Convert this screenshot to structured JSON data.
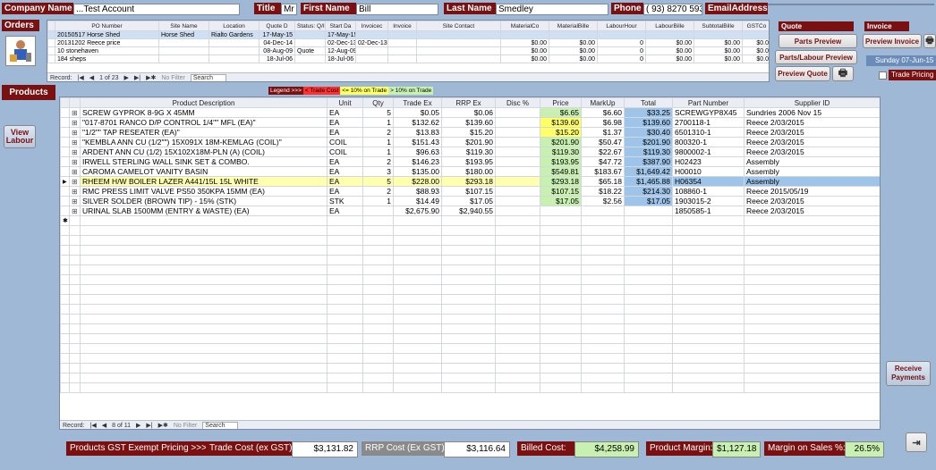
{
  "header": {
    "company_label": "Company Name",
    "company_value": "...Test Account",
    "title_label": "Title",
    "title_value": "Mr",
    "first_label": "First Name",
    "first_value": "Bill",
    "last_label": "Last Name",
    "last_value": "Smedley",
    "phone_label": "Phone",
    "phone_value": "( 93) 8270 5935",
    "email_label": "EmailAddress:",
    "email_value": ""
  },
  "orders": {
    "label": "Orders",
    "columns": [
      "PO Number",
      "Site Name",
      "Location",
      "Quote D",
      "Status: Q/I",
      "Start Da",
      "Invoicec",
      "Invoice",
      "Site Contact",
      "MaterialCo",
      "MaterialBille",
      "LabourHour",
      "LabourBille",
      "SubtotalBille",
      "GSTCo"
    ],
    "rows": [
      [
        "20150517 Horse Shed",
        "Horse Shed",
        "Rialto Gardens",
        "17-May-15",
        "",
        "17-May-15",
        "",
        "",
        "",
        "",
        "",
        "",
        "",
        "",
        ""
      ],
      [
        "20131202 Reece price",
        "",
        "",
        "04-Dec-14",
        "",
        "02-Dec-13",
        "02-Dec-13",
        "",
        "",
        "$0.00",
        "$0.00",
        "0",
        "$0.00",
        "$0.00",
        "$0.0"
      ],
      [
        "10 stonehaven",
        "",
        "",
        "08-Aug-09",
        "Quote",
        "12-Aug-09",
        "",
        "",
        "",
        "$0.00",
        "$0.00",
        "0",
        "$0.00",
        "$0.00",
        "$0.0"
      ],
      [
        "184 sheps",
        "",
        "",
        "18-Jul-06",
        "",
        "18-Jul-06",
        "",
        "",
        "",
        "$0.00",
        "$0.00",
        "0",
        "$0.00",
        "$0.00",
        "$0.0"
      ]
    ],
    "nav": {
      "record": "Record:",
      "pos": "1 of 23",
      "filter": "No Filter",
      "search": "Search"
    }
  },
  "quote": {
    "label": "Quote",
    "parts_preview": "Parts Preview",
    "parts_labour_preview": "Parts/Labour Preview",
    "preview_quote": "Preview Quote"
  },
  "invoice": {
    "label": "Invoice",
    "preview_invoice": "Preview Invoice",
    "date": "Sunday 07-Jun-15",
    "trade_pricing": "Trade Pricing"
  },
  "products": {
    "label": "Products",
    "view_labour": "View Labour",
    "legend": {
      "title": "Legend >>>",
      "red": "< Trade Cost",
      "yellow": "<= 10% on Trade",
      "green": "> 10% on Trade"
    },
    "columns": [
      "Product Description",
      "Unit",
      "Qty",
      "Trade Ex",
      "RRP Ex",
      "Disc %",
      "Price",
      "MarkUp",
      "Total",
      "Part Number",
      "Supplier ID"
    ],
    "rows": [
      {
        "desc": "SCREW GYPROK 8-9G X 45MM",
        "unit": "EA",
        "qty": "5",
        "trade": "$0.05",
        "rrp": "$0.06",
        "disc": "",
        "price": "$6.65",
        "markup": "$6.60",
        "total": "$33.25",
        "part": "SCREWGYP8X45",
        "supplier": "Sundries 2006 Nov 15",
        "pc": "green"
      },
      {
        "desc": "\"017-8701 RANCO D/P CONTROL 1/4\"\" MFL (EA)\"",
        "unit": "EA",
        "qty": "1",
        "trade": "$132.62",
        "rrp": "$139.60",
        "disc": "",
        "price": "$139.60",
        "markup": "$6.98",
        "total": "$139.60",
        "part": "2700118-1",
        "supplier": "Reece 2/03/2015",
        "pc": "yellow"
      },
      {
        "desc": "\"1/2\"\" TAP RESEATER (EA)\"",
        "unit": "EA",
        "qty": "2",
        "trade": "$13.83",
        "rrp": "$15.20",
        "disc": "",
        "price": "$15.20",
        "markup": "$1.37",
        "total": "$30.40",
        "part": "6501310-1",
        "supplier": "Reece 2/03/2015",
        "pc": "yellow"
      },
      {
        "desc": "\"KEMBLA ANN CU (1/2\"\") 15X091X 18M-KEMLAG (COIL)\"",
        "unit": "COIL",
        "qty": "1",
        "trade": "$151.43",
        "rrp": "$201.90",
        "disc": "",
        "price": "$201.90",
        "markup": "$50.47",
        "total": "$201.90",
        "part": "800320-1",
        "supplier": "Reece 2/03/2015",
        "pc": "green"
      },
      {
        "desc": "ARDENT ANN CU (1/2) 15X102X18M-PLN (A) (COIL)",
        "unit": "COIL",
        "qty": "1",
        "trade": "$96.63",
        "rrp": "$119.30",
        "disc": "",
        "price": "$119.30",
        "markup": "$22.67",
        "total": "$119.30",
        "part": "9800002-1",
        "supplier": "Reece 2/03/2015",
        "pc": "green"
      },
      {
        "desc": "IRWELL STERLING WALL SINK SET & COMBO.",
        "unit": "EA",
        "qty": "2",
        "trade": "$146.23",
        "rrp": "$193.95",
        "disc": "",
        "price": "$193.95",
        "markup": "$47.72",
        "total": "$387.90",
        "part": "H02423",
        "supplier": "Assembly",
        "pc": "green"
      },
      {
        "desc": "CAROMA CAMELOT VANITY BASIN",
        "unit": "EA",
        "qty": "3",
        "trade": "$135.00",
        "rrp": "$180.00",
        "disc": "",
        "price": "$549.81",
        "markup": "$183.67",
        "total": "$1,649.42",
        "part": "H00010",
        "supplier": "Assembly",
        "pc": "green"
      },
      {
        "desc": "RHEEM H/W BOILER LAZER A441/15L 15L WHITE",
        "unit": "EA",
        "qty": "5",
        "trade": "$228.00",
        "rrp": "$293.18",
        "disc": "",
        "price": "$293.18",
        "markup": "$65.18",
        "total": "$1,465.88",
        "part": "H06354",
        "supplier": "Assembly",
        "pc": "green",
        "selected": true
      },
      {
        "desc": "RMC PRESS LIMIT VALVE PS50  350KPA 15MM (EA)",
        "unit": "EA",
        "qty": "2",
        "trade": "$88.93",
        "rrp": "$107.15",
        "disc": "",
        "price": "$107.15",
        "markup": "$18.22",
        "total": "$214.30",
        "part": "108860-1",
        "supplier": "Reece 2015/05/19",
        "pc": "green"
      },
      {
        "desc": "SILVER SOLDER (BROWN TIP) - 15% (STK)",
        "unit": "STK",
        "qty": "1",
        "trade": "$14.49",
        "rrp": "$17.05",
        "disc": "",
        "price": "$17.05",
        "markup": "$2.56",
        "total": "$17.05",
        "part": "1903015-2",
        "supplier": "Reece 2/03/2015",
        "pc": "green"
      },
      {
        "desc": "URINAL SLAB  1500MM (ENTRY & WASTE) (EA)",
        "unit": "EA",
        "qty": "",
        "trade": "$2,675.90",
        "rrp": "$2,940.55",
        "disc": "",
        "price": "",
        "markup": "",
        "total": "",
        "part": "1850585-1",
        "supplier": "Reece 2/03/2015",
        "pc": "none"
      }
    ],
    "nav": {
      "record": "Record:",
      "pos": "8 of 11",
      "filter": "No Filter",
      "search": "Search"
    }
  },
  "receive_payments": "Receive Payments",
  "footer": {
    "gst_exempt": "Products GST Exempt Pricing >>>",
    "trade_cost_label": "Trade Cost (ex GST):",
    "trade_cost_value": "$3,131.82",
    "rrp_cost_label": "RRP Cost (Ex GST):",
    "rrp_cost_value": "$3,116.64",
    "billed_cost_label": "Billed Cost:",
    "billed_cost_value": "$4,258.99",
    "product_margin_label": "Product Margin:",
    "product_margin_value": "$1,127.18",
    "margin_sales_label": "Margin on Sales %:",
    "margin_sales_value": "26.5%"
  },
  "colors": {
    "maroon": "#7a1010",
    "green": "#c8f0b0",
    "yellow": "#ffff66",
    "blue": "#9ec4ea",
    "red": "#ff3030",
    "selected_row": "#ffffb0",
    "orders_selected": "#cfe0f4"
  }
}
